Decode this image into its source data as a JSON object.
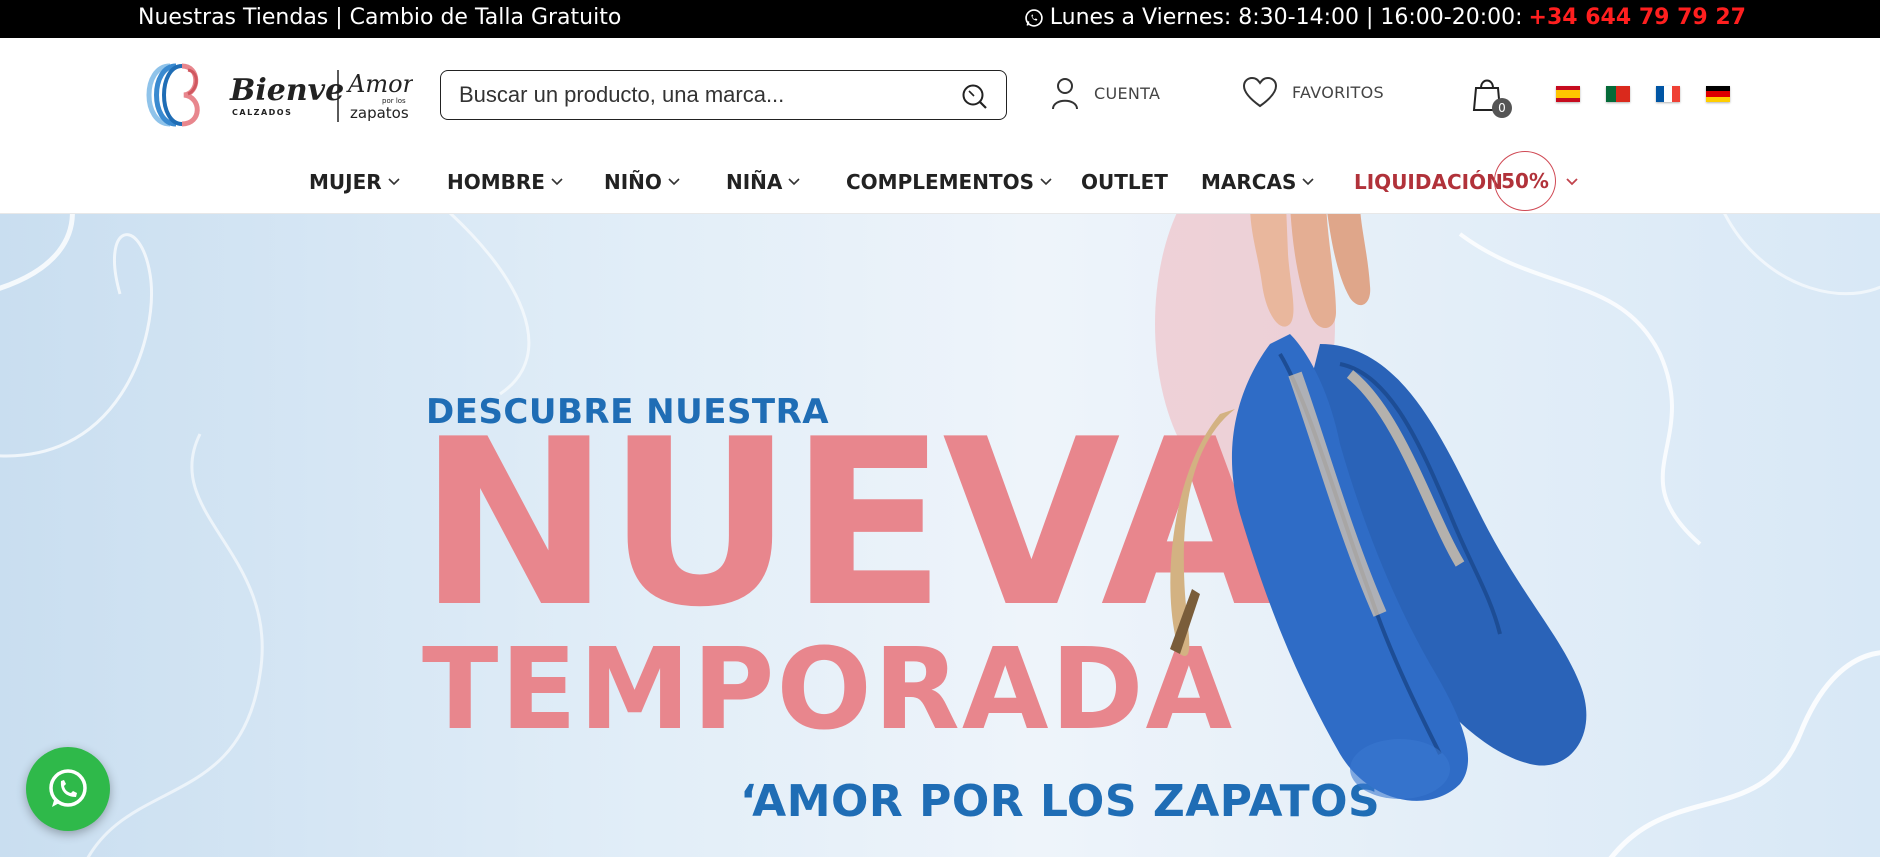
{
  "topbar": {
    "left_text": "Nuestras Tiendas | Cambio de Talla Gratuito",
    "hours_text": "Lunes a Viernes: 8:30-14:00 | 16:00-20:00:",
    "phone": "+34 644 79 79 27",
    "icon": "whatsapp-icon"
  },
  "header": {
    "logo": {
      "brand": "Bienve",
      "sub": "CALZADOS",
      "slogan_script": "Amor",
      "slogan_small": "por los",
      "slogan_word": "zapatos"
    },
    "search": {
      "placeholder": "Buscar un producto, una marca...",
      "icon": "search-icon"
    },
    "account_label": "CUENTA",
    "favorites_label": "FAVORITOS",
    "cart_count": "0",
    "languages": [
      "es",
      "pt",
      "fr",
      "de"
    ]
  },
  "nav": {
    "items": [
      {
        "label": "MUJER",
        "dropdown": true
      },
      {
        "label": "HOMBRE",
        "dropdown": true
      },
      {
        "label": "NIÑO",
        "dropdown": true
      },
      {
        "label": "NIÑA",
        "dropdown": true
      },
      {
        "label": "COMPLEMENTOS",
        "dropdown": true
      },
      {
        "label": "OUTLET",
        "dropdown": false
      },
      {
        "label": "MARCAS",
        "dropdown": true
      },
      {
        "label": "LIQUIDACIÓN",
        "dropdown": true
      }
    ],
    "sale_badge": "50%"
  },
  "hero": {
    "line1": "DESCUBRE NUESTRA",
    "line2": "NUEVA",
    "line3": "TEMPORADA",
    "tagline": "‘AMOR POR LOS ZAPATOS"
  },
  "colors": {
    "accent_red": "#ff1f1f",
    "brand_blue": "#1f6db5",
    "hero_pink": "#e8868d",
    "sale_red": "#b1323a",
    "whatsapp_green": "#2fb94a"
  }
}
